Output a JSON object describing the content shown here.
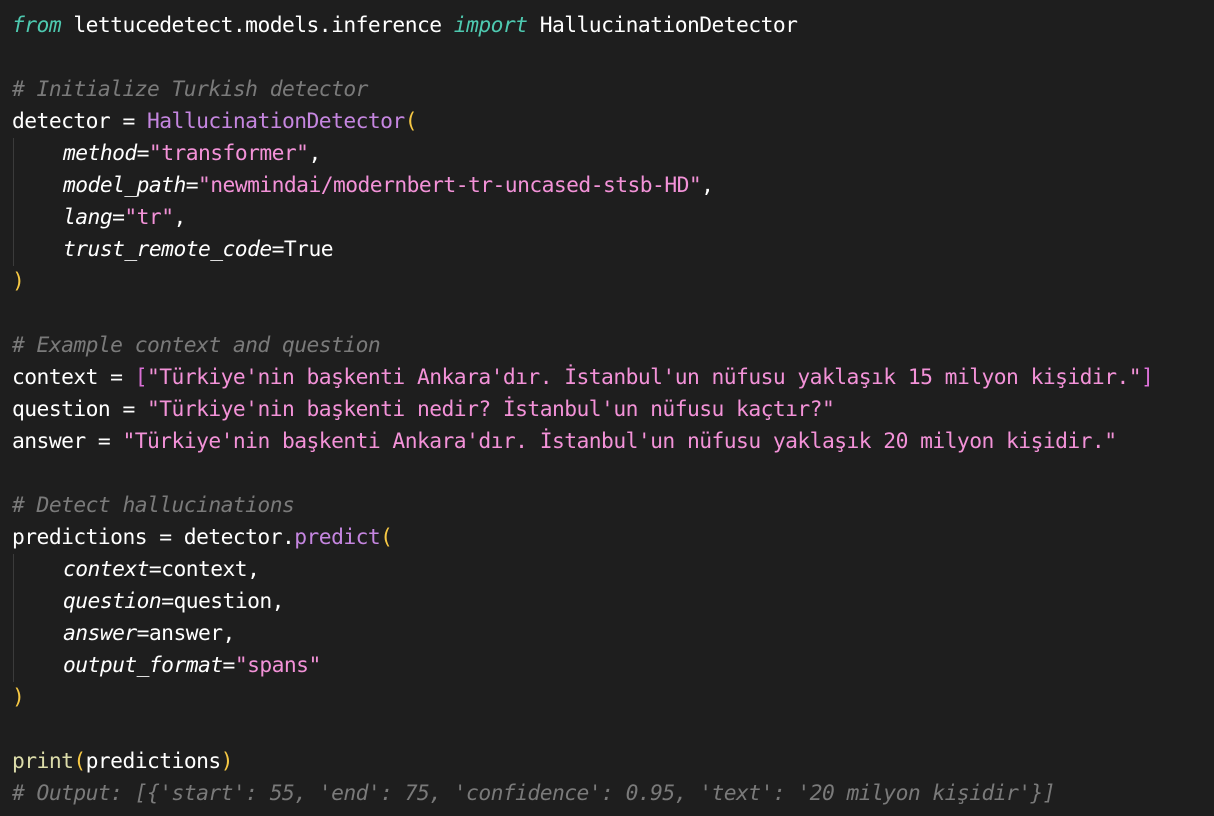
{
  "code": {
    "language": "python",
    "colors": {
      "background": "#1e1e1e",
      "keyword": "#4ec9b0",
      "comment": "#7a7a7a",
      "function": "#c586e0",
      "string": "#f392d8",
      "paren": "#f6c844",
      "bracket": "#da70d6",
      "builtin": "#dcdcaa",
      "text": "#ffffff"
    },
    "lines": [
      {
        "tokens": [
          {
            "t": "kw",
            "v": "from"
          },
          {
            "t": "pl",
            "v": " lettucedetect.models.inference "
          },
          {
            "t": "kw",
            "v": "import"
          },
          {
            "t": "pl",
            "v": " HallucinationDetector"
          }
        ]
      },
      {
        "tokens": []
      },
      {
        "tokens": [
          {
            "t": "cm",
            "v": "# Initialize Turkish detector"
          }
        ]
      },
      {
        "tokens": [
          {
            "t": "pl",
            "v": "detector = "
          },
          {
            "t": "fn",
            "v": "HallucinationDetector"
          },
          {
            "t": "par",
            "v": "("
          }
        ]
      },
      {
        "indent": 1,
        "tokens": [
          {
            "t": "arg",
            "v": "method"
          },
          {
            "t": "pl",
            "v": "="
          },
          {
            "t": "str",
            "v": "\"transformer\""
          },
          {
            "t": "pl",
            "v": ","
          }
        ]
      },
      {
        "indent": 1,
        "tokens": [
          {
            "t": "arg",
            "v": "model_path"
          },
          {
            "t": "pl",
            "v": "="
          },
          {
            "t": "str",
            "v": "\"newmindai/modernbert-tr-uncased-stsb-HD\""
          },
          {
            "t": "pl",
            "v": ","
          }
        ]
      },
      {
        "indent": 1,
        "tokens": [
          {
            "t": "arg",
            "v": "lang"
          },
          {
            "t": "pl",
            "v": "="
          },
          {
            "t": "str",
            "v": "\"tr\""
          },
          {
            "t": "pl",
            "v": ","
          }
        ]
      },
      {
        "indent": 1,
        "tokens": [
          {
            "t": "arg",
            "v": "trust_remote_code"
          },
          {
            "t": "pl",
            "v": "=True"
          }
        ]
      },
      {
        "tokens": [
          {
            "t": "par",
            "v": ")"
          }
        ]
      },
      {
        "tokens": []
      },
      {
        "tokens": [
          {
            "t": "cm",
            "v": "# Example context and question"
          }
        ]
      },
      {
        "tokens": [
          {
            "t": "pl",
            "v": "context = "
          },
          {
            "t": "brk",
            "v": "["
          },
          {
            "t": "str",
            "v": "\"Türkiye'nin başkenti Ankara'dır. İstanbul'un nüfusu yaklaşık 15 milyon kişidir.\""
          },
          {
            "t": "brk",
            "v": "]"
          }
        ]
      },
      {
        "tokens": [
          {
            "t": "pl",
            "v": "question = "
          },
          {
            "t": "str",
            "v": "\"Türkiye'nin başkenti nedir? İstanbul'un nüfusu kaçtır?\""
          }
        ]
      },
      {
        "tokens": [
          {
            "t": "pl",
            "v": "answer = "
          },
          {
            "t": "str",
            "v": "\"Türkiye'nin başkenti Ankara'dır. İstanbul'un nüfusu yaklaşık 20 milyon kişidir.\""
          }
        ]
      },
      {
        "tokens": []
      },
      {
        "tokens": [
          {
            "t": "cm",
            "v": "# Detect hallucinations"
          }
        ]
      },
      {
        "tokens": [
          {
            "t": "pl",
            "v": "predictions = detector."
          },
          {
            "t": "fn",
            "v": "predict"
          },
          {
            "t": "par",
            "v": "("
          }
        ]
      },
      {
        "indent": 1,
        "tokens": [
          {
            "t": "arg",
            "v": "context"
          },
          {
            "t": "pl",
            "v": "=context,"
          }
        ]
      },
      {
        "indent": 1,
        "tokens": [
          {
            "t": "arg",
            "v": "question"
          },
          {
            "t": "pl",
            "v": "=question,"
          }
        ]
      },
      {
        "indent": 1,
        "tokens": [
          {
            "t": "arg",
            "v": "answer"
          },
          {
            "t": "pl",
            "v": "=answer,"
          }
        ]
      },
      {
        "indent": 1,
        "tokens": [
          {
            "t": "arg",
            "v": "output_format"
          },
          {
            "t": "pl",
            "v": "="
          },
          {
            "t": "str",
            "v": "\"spans\""
          }
        ]
      },
      {
        "tokens": [
          {
            "t": "par",
            "v": ")"
          }
        ]
      },
      {
        "tokens": []
      },
      {
        "tokens": [
          {
            "t": "bi",
            "v": "print"
          },
          {
            "t": "par",
            "v": "("
          },
          {
            "t": "pl",
            "v": "predictions"
          },
          {
            "t": "par",
            "v": ")"
          }
        ]
      },
      {
        "tokens": [
          {
            "t": "cm",
            "v": "# Output: [{'start': 55, 'end': 75, 'confidence': 0.95, 'text': '20 milyon kişidir'}]"
          }
        ]
      }
    ]
  }
}
